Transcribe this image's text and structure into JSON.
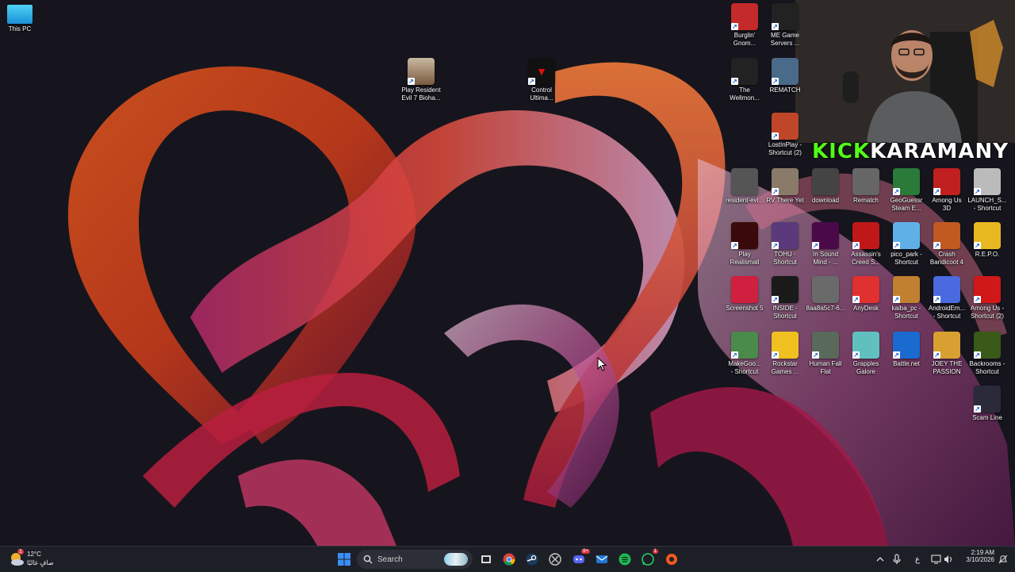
{
  "desktop": {
    "left_icons": [
      {
        "name": "this-pc-icon",
        "label": "This PC"
      },
      {
        "name": "resident-evil-7-shortcut",
        "label": "Play Resident\nEvil 7 Bioha..."
      },
      {
        "name": "control-ultimate-shortcut",
        "label": "Control\nUltima..."
      }
    ],
    "right_icons": [
      {
        "name": "burglin-gnomes-shortcut",
        "label": "Burglin'\nGnom..."
      },
      {
        "name": "me-game-servers-shortcut",
        "label": "ME Game\nServers ..."
      },
      {
        "name": "the-wellmon-shortcut",
        "label": "The\nWellmon..."
      },
      {
        "name": "rematch-shortcut",
        "label": "REMATCH"
      },
      {
        "name": "lostinplay-shortcut",
        "label": "LostInPlay -\nShortcut (2)"
      },
      {
        "name": "resident-evil-file",
        "label": "resident-evi..."
      },
      {
        "name": "rv-there-yet-shortcut",
        "label": "RV There Yet"
      },
      {
        "name": "download-file",
        "label": "download"
      },
      {
        "name": "rematch-file",
        "label": "Rematch"
      },
      {
        "name": "geoguessr-shortcut",
        "label": "GeoGuessr\nSteam E..."
      },
      {
        "name": "among-us-3d-shortcut",
        "label": "Among Us\n3D"
      },
      {
        "name": "launch-shortcut",
        "label": "LAUNCH_S...\n- Shortcut"
      },
      {
        "name": "play-realismall-shortcut",
        "label": "Play\nRealismall"
      },
      {
        "name": "tohu-shortcut",
        "label": "TOHU -\nShortcut"
      },
      {
        "name": "in-sound-mind-shortcut",
        "label": "In Sound\nMind - ..."
      },
      {
        "name": "assassins-creed-shortcut",
        "label": "Assassin's\nCreed S..."
      },
      {
        "name": "pico-park-shortcut",
        "label": "pico_park -\nShortcut"
      },
      {
        "name": "crash-bandicoot-shortcut",
        "label": "Crash\nBandicoot 4"
      },
      {
        "name": "repo-shortcut",
        "label": "R.E.P.O."
      },
      {
        "name": "screenshot-file",
        "label": "Screenshot 5"
      },
      {
        "name": "inside-shortcut",
        "label": "INSIDE -\nShortcut"
      },
      {
        "name": "image-file",
        "label": "8aa8a5c7-6..."
      },
      {
        "name": "anydesk-shortcut",
        "label": "AnyDesk"
      },
      {
        "name": "kaiba-pc-shortcut",
        "label": "kaiba_pc -\nShortcut"
      },
      {
        "name": "android-emu-shortcut",
        "label": "AndroidEm...\n- Shortcut"
      },
      {
        "name": "among-us-2-shortcut",
        "label": "Among Us -\nShortcut (2)"
      },
      {
        "name": "makegoo-shortcut",
        "label": "MakeGoo...\n- Shortcut"
      },
      {
        "name": "rockstar-games-shortcut",
        "label": "Rockstar\nGames ..."
      },
      {
        "name": "human-fall-flat-shortcut",
        "label": "Human Fall\nFlat"
      },
      {
        "name": "grapples-galore-shortcut",
        "label": "Grapples\nGalore"
      },
      {
        "name": "battlenet-shortcut",
        "label": "Battle.net"
      },
      {
        "name": "joey-passion-shortcut",
        "label": "JOEY THE\nPASSION"
      },
      {
        "name": "backrooms-shortcut",
        "label": "Backrooms -\nShortcut"
      },
      {
        "name": "scam-line-shortcut",
        "label": "Scam Line"
      }
    ]
  },
  "overlay": {
    "kick": "KICK",
    "channel": "KARAMANY"
  },
  "taskbar": {
    "weather_temp": "12°C",
    "weather_desc": "صافٍ غالبًا",
    "weather_badge": "1",
    "search_placeholder": "Search",
    "discord_badge": "9+",
    "whatsapp_badge": "1",
    "lang": "ع",
    "time": "2:19 AM",
    "date": "3/10/2026"
  },
  "colors": {
    "taskbar_bg": "#1d1f27",
    "kick_green": "#53fc18",
    "windows_blue": "#3a8ef6"
  }
}
